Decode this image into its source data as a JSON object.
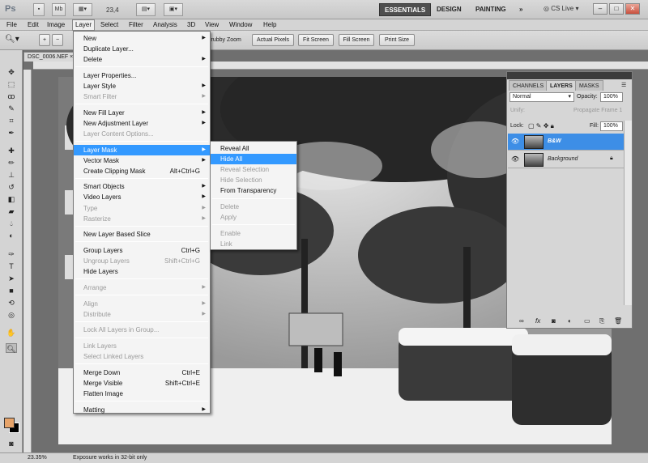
{
  "app": {
    "logo": "Ps",
    "mb": "Mb",
    "zoom": "23,4",
    "live": "CS Live"
  },
  "workspaces": [
    "ESSENTIALS",
    "DESIGN",
    "PAINTING",
    "»"
  ],
  "menubar": [
    "File",
    "Edit",
    "Image",
    "Layer",
    "Select",
    "Filter",
    "Analysis",
    "3D",
    "View",
    "Window",
    "Help"
  ],
  "options": {
    "scrubby": "crubby Zoom",
    "actual": "Actual Pixels",
    "fit": "Fit Screen",
    "fill": "Fill Screen",
    "print": "Print Size"
  },
  "document": {
    "tab": "DSC_0006.NEF"
  },
  "status": {
    "zoom": "23.35%",
    "message": "Exposure works in 32-bit only"
  },
  "layer_menu": [
    {
      "label": "New",
      "arrow": true
    },
    {
      "label": "Duplicate Layer..."
    },
    {
      "label": "Delete",
      "arrow": true
    },
    {
      "sep": true
    },
    {
      "label": "Layer Properties..."
    },
    {
      "label": "Layer Style",
      "arrow": true
    },
    {
      "label": "Smart Filter",
      "arrow": true,
      "disabled": true
    },
    {
      "sep": true
    },
    {
      "label": "New Fill Layer",
      "arrow": true
    },
    {
      "label": "New Adjustment Layer",
      "arrow": true
    },
    {
      "label": "Layer Content Options...",
      "disabled": true
    },
    {
      "sep": true
    },
    {
      "label": "Layer Mask",
      "arrow": true,
      "highlight": true
    },
    {
      "label": "Vector Mask",
      "arrow": true
    },
    {
      "label": "Create Clipping Mask",
      "shortcut": "Alt+Ctrl+G"
    },
    {
      "sep": true
    },
    {
      "label": "Smart Objects",
      "arrow": true
    },
    {
      "label": "Video Layers",
      "arrow": true
    },
    {
      "label": "Type",
      "arrow": true,
      "disabled": true
    },
    {
      "label": "Rasterize",
      "arrow": true,
      "disabled": true
    },
    {
      "sep": true
    },
    {
      "label": "New Layer Based Slice"
    },
    {
      "sep": true
    },
    {
      "label": "Group Layers",
      "shortcut": "Ctrl+G"
    },
    {
      "label": "Ungroup Layers",
      "shortcut": "Shift+Ctrl+G",
      "disabled": true
    },
    {
      "label": "Hide Layers"
    },
    {
      "sep": true
    },
    {
      "label": "Arrange",
      "arrow": true,
      "disabled": true
    },
    {
      "sep": true
    },
    {
      "label": "Align",
      "arrow": true,
      "disabled": true
    },
    {
      "label": "Distribute",
      "arrow": true,
      "disabled": true
    },
    {
      "sep": true
    },
    {
      "label": "Lock All Layers in Group...",
      "disabled": true
    },
    {
      "sep": true
    },
    {
      "label": "Link Layers",
      "disabled": true
    },
    {
      "label": "Select Linked Layers",
      "disabled": true
    },
    {
      "sep": true
    },
    {
      "label": "Merge Down",
      "shortcut": "Ctrl+E"
    },
    {
      "label": "Merge Visible",
      "shortcut": "Shift+Ctrl+E"
    },
    {
      "label": "Flatten Image"
    },
    {
      "sep": true
    },
    {
      "label": "Matting",
      "arrow": true
    }
  ],
  "mask_submenu": [
    {
      "label": "Reveal All"
    },
    {
      "label": "Hide All",
      "highlight": true
    },
    {
      "label": "Reveal Selection",
      "disabled": true
    },
    {
      "label": "Hide Selection",
      "disabled": true
    },
    {
      "label": "From Transparency"
    },
    {
      "sep": true
    },
    {
      "label": "Delete",
      "disabled": true
    },
    {
      "label": "Apply",
      "disabled": true
    },
    {
      "sep": true
    },
    {
      "label": "Enable",
      "disabled": true
    },
    {
      "label": "Link",
      "disabled": true
    }
  ],
  "panel": {
    "tabs": [
      "CHANNELS",
      "LAYERS",
      "MASKS"
    ],
    "blend_mode": "Normal",
    "opacity_label": "Opacity:",
    "opacity": "100%",
    "unify": "Unify:",
    "propagate": "Propagate Frame 1",
    "lock": "Lock:",
    "fill_label": "Fill:",
    "fill": "100%",
    "layers": [
      {
        "name": "B&W",
        "selected": true
      },
      {
        "name": "Background",
        "selected": false
      }
    ]
  }
}
